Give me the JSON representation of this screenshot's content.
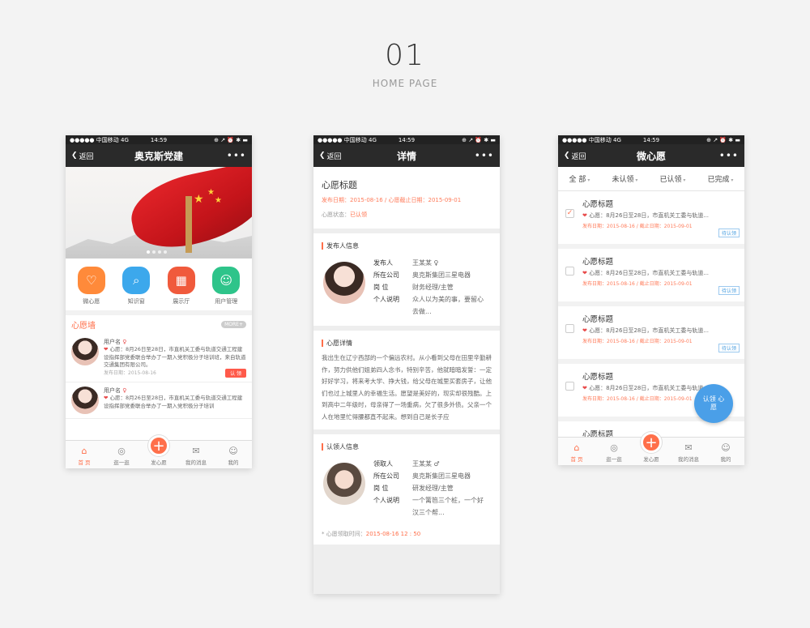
{
  "header": {
    "number": "01",
    "subtitle": "HOME PAGE"
  },
  "status_bar": {
    "carrier": "●●●●● 中国移动  4G",
    "time": "14:59",
    "icons": "⊕ ↗ ⏰ ✱ ▬"
  },
  "nav": {
    "back": "返回",
    "more": "•••"
  },
  "phone1": {
    "title": "奥克斯党建",
    "quick_items": [
      {
        "label": "微心愿",
        "color": "#ff8a3a",
        "icon": "heart-icon"
      },
      {
        "label": "知识窗",
        "color": "#3ca8ec",
        "icon": "search-icon"
      },
      {
        "label": "展示厅",
        "color": "#f05a3c",
        "icon": "store-icon"
      },
      {
        "label": "用户管理",
        "color": "#2ec48a",
        "icon": "users-icon"
      }
    ],
    "section_title": "心愿墙",
    "more": "MORE+",
    "wishes": [
      {
        "user": "用户名",
        "text": "心愿：8月26日至28日，市直机关工委与轨道交通工程建设指挥部党委联合举办了一期入党积极分子培训班，来自轨道交通集团有限公司。",
        "date": "发布日期：2015-08-16",
        "badge": "认 领"
      },
      {
        "user": "用户名",
        "text": "心愿：8月26日至28日，市直机关工委与轨道交通工程建设指挥部党委联合举办了一期入党积极分子培训",
        "date": "",
        "badge": ""
      }
    ],
    "tabs": [
      {
        "label": "首 页",
        "icon": "⌂"
      },
      {
        "label": "逛一逛",
        "icon": "◎"
      },
      {
        "label": "发心愿",
        "icon": "+"
      },
      {
        "label": "我的消息",
        "icon": "✉"
      },
      {
        "label": "我的",
        "icon": "☺"
      }
    ]
  },
  "phone2": {
    "title": "详情",
    "wish_title": "心愿标题",
    "dates": "发布日期：2015-08-16    /    心愿截止日期：2015-09-01",
    "status_label": "心愿状态：",
    "status_value": "已认领",
    "publisher_head": "发布人信息",
    "publisher": [
      {
        "k": "发布人",
        "v": "王某某 ♀"
      },
      {
        "k": "所在公司",
        "v": "奥克斯集团三星电器"
      },
      {
        "k": "岗 位",
        "v": "财务经理/主管"
      },
      {
        "k": "个人说明",
        "v": "众人以为美的事，要留心去做..."
      }
    ],
    "detail_head": "心愿详情",
    "detail_text": "我出生在辽宁西部的一个偏远农村。从小看到父母在田里辛勤耕作，努力供他们姐弟四人念书，特别辛苦，他就暗暗发誓：一定好好学习，将来考大学、挣大钱，给父母在城里买套房子，让他们也过上城里人的幸福生活。愿望是美好的，现实却很残酷。上到高中二年级时，母亲得了一场重病，欠了很多外债。父亲一个人在地里忙得腰都直不起来。想到自己是长子应",
    "claimer_head": "认领人信息",
    "claimer": [
      {
        "k": "领取人",
        "v": "王某某 ♂"
      },
      {
        "k": "所在公司",
        "v": "奥克斯集团三星电器"
      },
      {
        "k": "岗 位",
        "v": "研发经理/主管"
      },
      {
        "k": "个人说明",
        "v": "一个篱笆三个桩，一个好汉三个帮..."
      }
    ],
    "claim_time_label": "* 心愿领取时间：",
    "claim_time": "2015-08-16    12 : 50"
  },
  "phone3": {
    "title": "微心愿",
    "filters": [
      "全 部",
      "未认领",
      "已认领",
      "已完成"
    ],
    "items": [
      {
        "title": "心愿标题",
        "text": "心愿：8月26日至28日，市直机关工委与轨道...",
        "dates": "发布日期：2015-08-16    /    截止日期：2015-09-01",
        "tag": "待认领",
        "checked": "✓"
      },
      {
        "title": "心愿标题",
        "text": "心愿：8月26日至28日，市直机关工委与轨道...",
        "dates": "发布日期：2015-08-16    /    截止日期：2015-09-01",
        "tag": "待认领",
        "checked": ""
      },
      {
        "title": "心愿标题",
        "text": "心愿：8月26日至28日，市直机关工委与轨道...",
        "dates": "发布日期：2015-08-16    /    截止日期：2015-09-01",
        "tag": "待认领",
        "checked": ""
      },
      {
        "title": "心愿标题",
        "text": "心愿：8月26日至28日，市直机关工委与轨道...",
        "dates": "发布日期：2015-08-16    /    截止日期：2015-09-01",
        "tag": "",
        "checked": ""
      },
      {
        "title": "心愿标题",
        "text": "",
        "dates": "",
        "tag": "",
        "checked": ""
      }
    ],
    "float_button": "认领 心愿"
  }
}
